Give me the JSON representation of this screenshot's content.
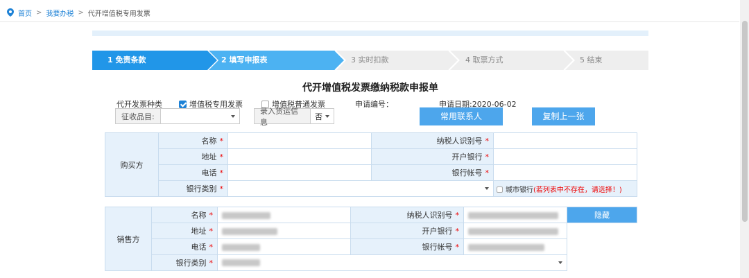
{
  "breadcrumb": {
    "home": "首页",
    "sep1": ">",
    "tax": "我要办税",
    "sep2": ">",
    "current": "代开增值税专用发票"
  },
  "steps": [
    {
      "label": "1  免责条款"
    },
    {
      "label": "2  填写申报表"
    },
    {
      "label": "3  实时扣款"
    },
    {
      "label": "4  取票方式"
    },
    {
      "label": "5  结束"
    }
  ],
  "colors": {
    "step_done": "#2196e8",
    "step_active": "#4cb2f2",
    "step_todo": "#eeeeee",
    "accent": "#4da6ec",
    "party_bg": "#e6f1fb"
  },
  "form": {
    "title": "代开增值税发票缴纳税款申报单",
    "invoice_type_label": "代开发票种类",
    "opt_special": "增值税专用发票",
    "opt_normal": "增值税普通发票",
    "app_no_label": "申请编号：",
    "app_date": "申请日期:2020-06-02",
    "tax_item_label": "征收品目:",
    "tax_item_value": "",
    "cargo_label": "录入货运信息",
    "cargo_value": "否",
    "btn_contacts": "常用联系人",
    "btn_copy": "复制上一张"
  },
  "buyer": {
    "party": "购买方",
    "name_label": "名称",
    "taxid_label": "纳税人识别号",
    "addr_label": "地址",
    "bank_label": "开户银行",
    "phone_label": "电话",
    "account_label": "银行帐号",
    "banktype_label": "银行类别",
    "star": "*",
    "city_bank": "城市银行",
    "city_bank_note": "(若列表中不存在，请选择！)"
  },
  "seller": {
    "party": "销售方",
    "name_label": "名称",
    "taxid_label": "纳税人识别号",
    "addr_label": "地址",
    "bank_label": "开户银行",
    "phone_label": "电话",
    "account_label": "银行帐号",
    "banktype_label": "银行类别",
    "star": "*",
    "hide_btn": "隐藏"
  }
}
